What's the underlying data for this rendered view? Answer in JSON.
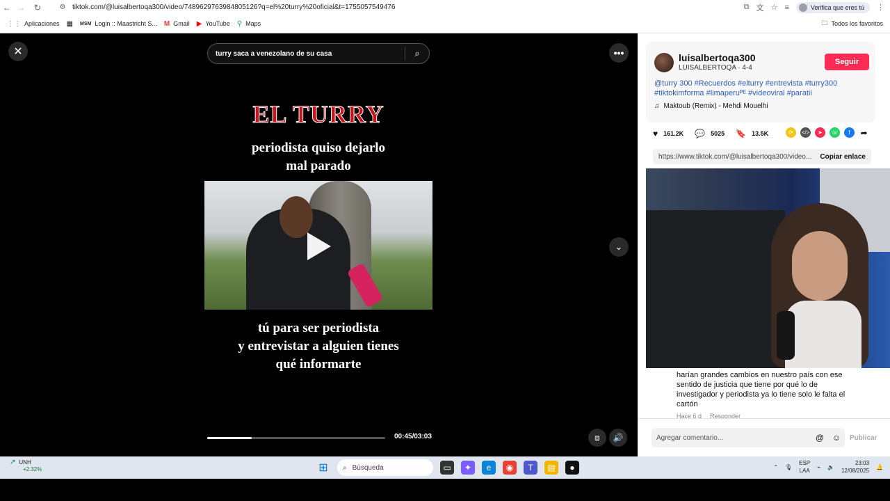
{
  "browser": {
    "url": "tiktok.com/@luisalbertoqa300/video/7489629763984805126?q=el%20turry%20oficial&t=1755057549476",
    "verify_label": "Verifica que eres tú",
    "bookmarks": [
      {
        "label": "Aplicaciones",
        "icon": "apps-grid-icon"
      },
      {
        "label": "Login :: Maastricht S...",
        "icon": "msu-icon"
      },
      {
        "label": "Gmail",
        "icon": "gmail-icon"
      },
      {
        "label": "YouTube",
        "icon": "youtube-icon"
      },
      {
        "label": "Maps",
        "icon": "maps-icon"
      }
    ],
    "all_favorites": "Todos los favoritos"
  },
  "video": {
    "search_query": "turry saca a venezolano de su casa",
    "title_text": "EL TURRY",
    "caption_top_1": "periodista quiso dejarlo",
    "caption_top_2": "mal parado",
    "caption_bottom_1": "tú para ser periodista",
    "caption_bottom_2": "y entrevistar a alguien tienes",
    "caption_bottom_3": "qué informarte",
    "time": "00:45/03:03",
    "progress": 0.25
  },
  "post": {
    "username": "luisalbertoqa300",
    "subtitle": "LUISALBERTOQA · 4-4",
    "follow_label": "Seguir",
    "description": "@turry 300 #Recuerdos #elturry #entrevista #turry300 #tiktokimforma #limaperuᴾᴱ #videoviral #paratii",
    "music": "Maktoub (Remix) - Mehdi Mouelhi",
    "likes": "161.2K",
    "comments": "5025",
    "saves": "13.5K",
    "link": "https://www.tiktok.com/@luisalbertoqa300/video...",
    "copy_label": "Copiar enlace"
  },
  "comment": {
    "text": "harían grandes cambios en nuestro país con ese sentido de justicia que tiene por qué lo de investigador y periodista ya lo tiene solo le falta el cartón",
    "time": "Hace 6 d",
    "reply": "Responder",
    "placeholder": "Agregar comentario...",
    "publish": "Publicar"
  },
  "taskbar": {
    "stock_name": "UNH",
    "stock_change": "+2.32%",
    "search_label": "Búsqueda",
    "lang_1": "ESP",
    "lang_2": "LAA",
    "time": "23:03",
    "date": "12/08/2025"
  }
}
